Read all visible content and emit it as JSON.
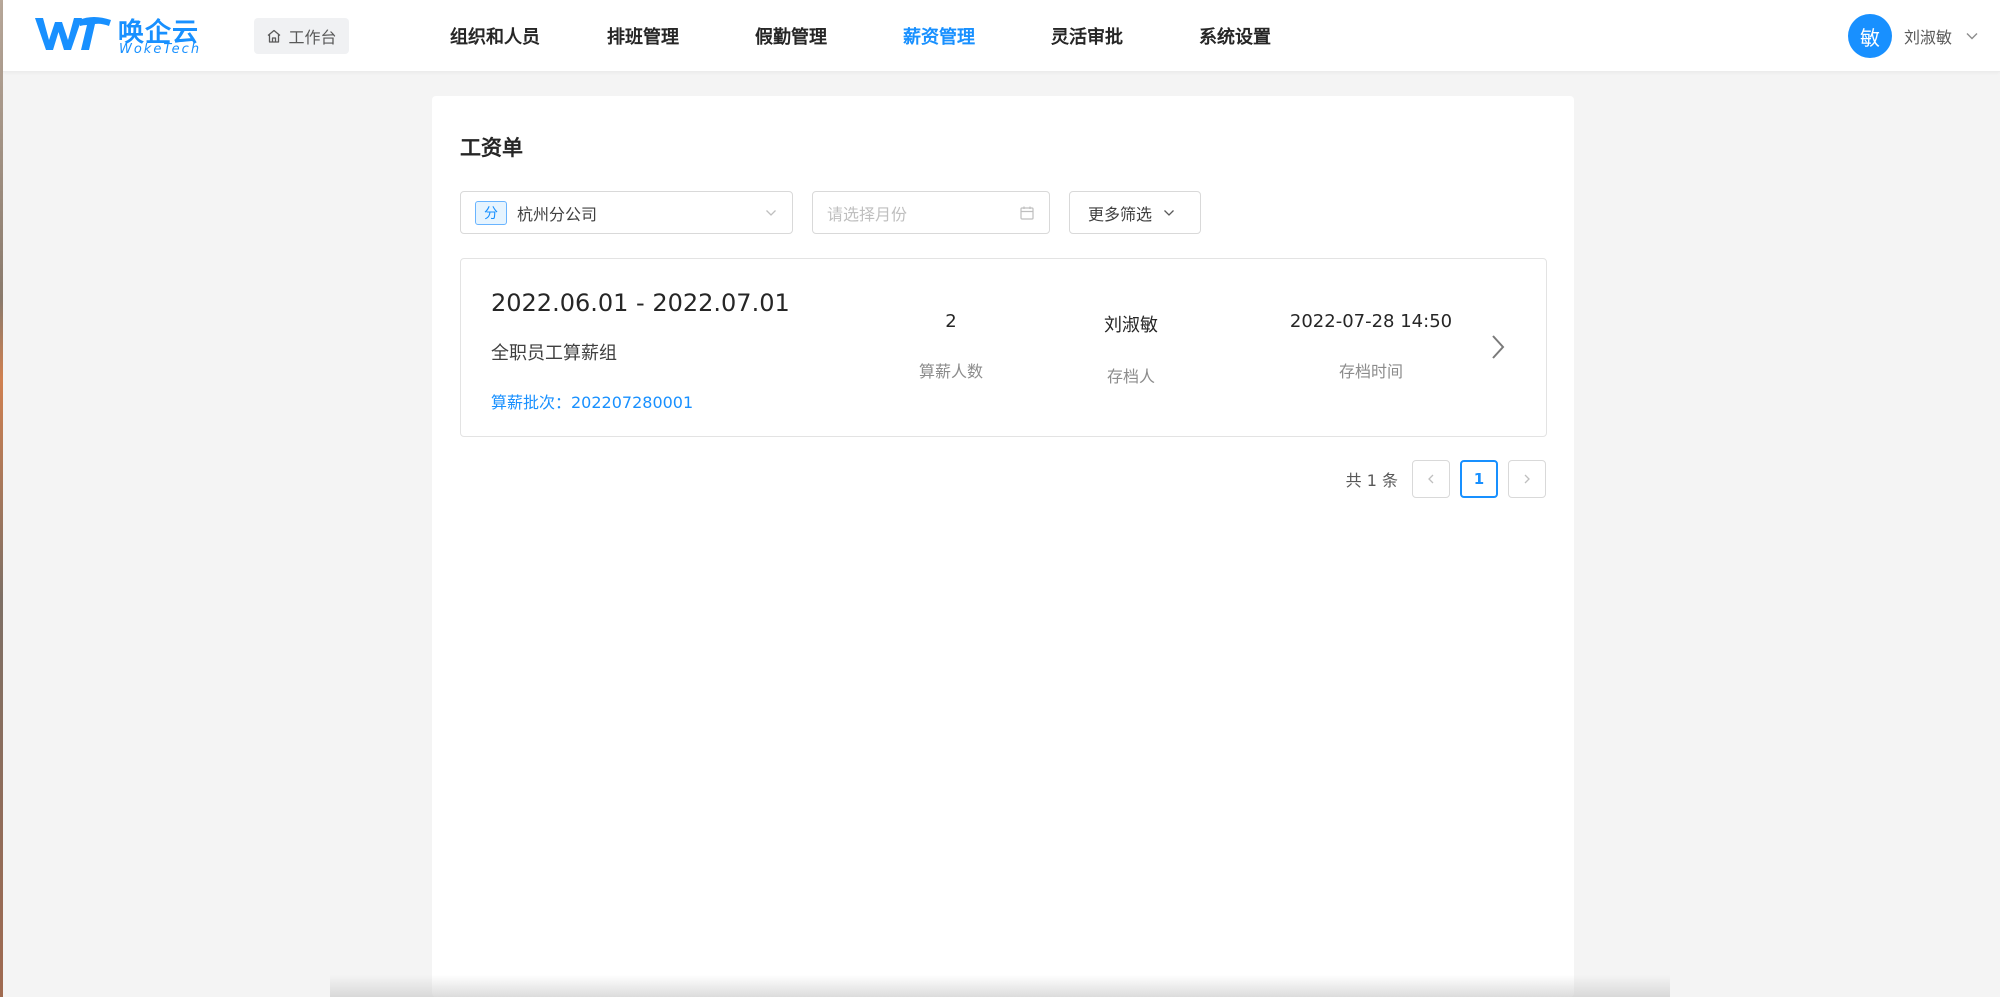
{
  "brand": {
    "name_cn": "唤企云",
    "name_en": "WokeTech",
    "color": "#1890ff"
  },
  "header": {
    "workbench_label": "工作台",
    "nav": [
      {
        "label": "组织和人员",
        "active": false
      },
      {
        "label": "排班管理",
        "active": false
      },
      {
        "label": "假勤管理",
        "active": false
      },
      {
        "label": "薪资管理",
        "active": true
      },
      {
        "label": "灵活审批",
        "active": false
      },
      {
        "label": "系统设置",
        "active": false
      }
    ],
    "user": {
      "avatar_text": "敏",
      "name": "刘淑敏"
    }
  },
  "page": {
    "title": "工资单",
    "filters": {
      "company_tag": "分",
      "company_value": "杭州分公司",
      "month_placeholder": "请选择月份",
      "more_label": "更多筛选"
    },
    "payrolls": [
      {
        "range": "2022.06.01 - 2022.07.01",
        "group": "全职员工算薪组",
        "batch": "算薪批次：202207280001",
        "count": "2",
        "count_label": "算薪人数",
        "archiver": "刘淑敏",
        "archiver_label": "存档人",
        "archive_time": "2022-07-28 14:50",
        "archive_time_label": "存档时间"
      }
    ],
    "pagination": {
      "total_text": "共 1 条",
      "current_page": "1"
    }
  }
}
